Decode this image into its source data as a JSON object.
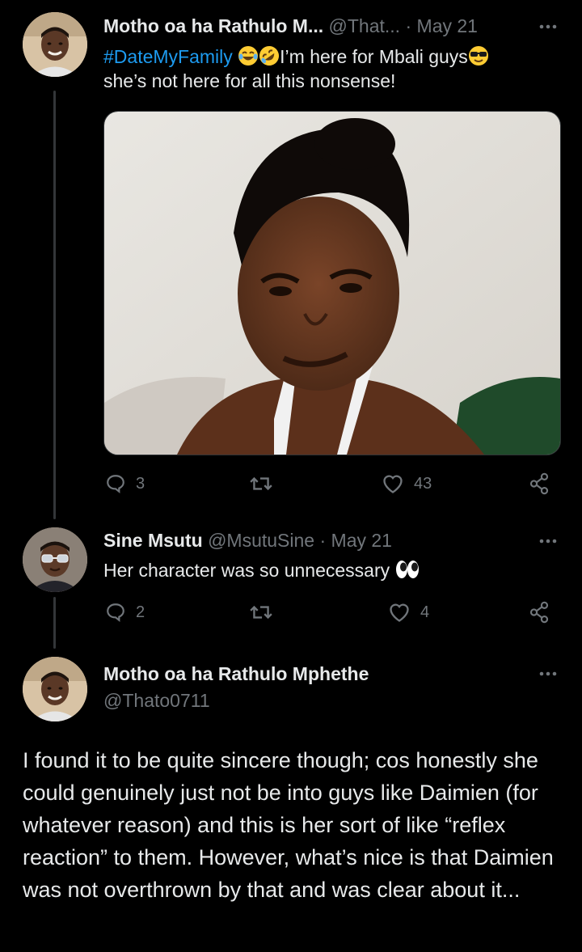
{
  "thread": {
    "tweet1": {
      "author_name": "Motho oa ha Rathulo M...",
      "handle": "@That...",
      "separator": "·",
      "date": "May 21",
      "hashtag": "#DateMyFamily",
      "text_after_emojis": "I’m here for Mbali guys",
      "text_line2": "she’s not here for all this nonsense!",
      "emojis": [
        "joy-emoji",
        "rofl-emoji",
        "sunglasses-emoji"
      ],
      "replies": "3",
      "retweets": "",
      "likes": "43"
    },
    "tweet2": {
      "author_name": "Sine Msutu",
      "handle": "@MsutuSine",
      "separator": "·",
      "date": "May 21",
      "text": "Her character was so unnecessary",
      "emojis": [
        "eyes-emoji"
      ],
      "replies": "2",
      "retweets": "",
      "likes": "4"
    },
    "tweet3": {
      "author_name": "Motho oa ha Rathulo Mphethe",
      "handle": "@Thato0711",
      "text": "I found it to be quite sincere though; cos honestly she could genuinely just not be into guys like Daimien (for whatever reason) and this is her sort of like “reflex reaction” to them. However, what’s nice is that Daimien was not overthrown by that and was clear about it..."
    }
  },
  "colors": {
    "background": "#000000",
    "text": "#e7e9ea",
    "muted": "#71767b",
    "link": "#1d9bf0",
    "thread_line": "#333639"
  }
}
